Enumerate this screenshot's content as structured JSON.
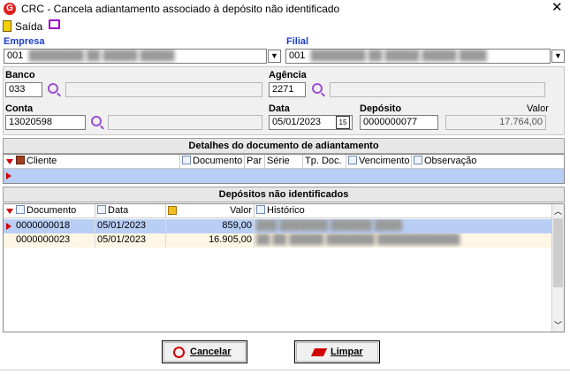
{
  "window": {
    "title": "CRC - Cancela adiantamento associado à depósito não identificado",
    "logo_letter": "G",
    "close_glyph": "✕"
  },
  "toolbar": {
    "exit_label": "Saída"
  },
  "empresa": {
    "label": "Empresa",
    "value": "001"
  },
  "filial": {
    "label": "Filial",
    "value": "001"
  },
  "banco": {
    "label": "Banco",
    "value": "033"
  },
  "agencia": {
    "label": "Agência",
    "value": "2271"
  },
  "conta": {
    "label": "Conta",
    "value": "13020598"
  },
  "data": {
    "label": "Data",
    "value": "05/01/2023"
  },
  "deposito": {
    "label": "Depósito",
    "value": "0000000077"
  },
  "valor": {
    "label": "Valor",
    "value": "17.764,00"
  },
  "detalhes": {
    "title": "Detalhes do documento de adiantamento",
    "columns": [
      "Cliente",
      "Documento",
      "Par",
      "Série",
      "Tp. Doc.",
      "Vencimento",
      "Observação"
    ]
  },
  "depositos": {
    "title": "Depósitos não identificados",
    "columns": [
      "Documento",
      "Data",
      "Valor",
      "Histórico"
    ],
    "rows": [
      {
        "documento": "0000000018",
        "data": "05/01/2023",
        "valor": "859,00"
      },
      {
        "documento": "0000000023",
        "data": "05/01/2023",
        "valor": "16.905,00"
      }
    ]
  },
  "buttons": {
    "cancel_label": "Cancelar",
    "clear_label": "Limpar"
  },
  "colors": {
    "accent_blue": "#1a3ccf",
    "selection": "#b8cef5",
    "highlight_row": "#fdf6e4",
    "brand_red": "#e02020"
  }
}
